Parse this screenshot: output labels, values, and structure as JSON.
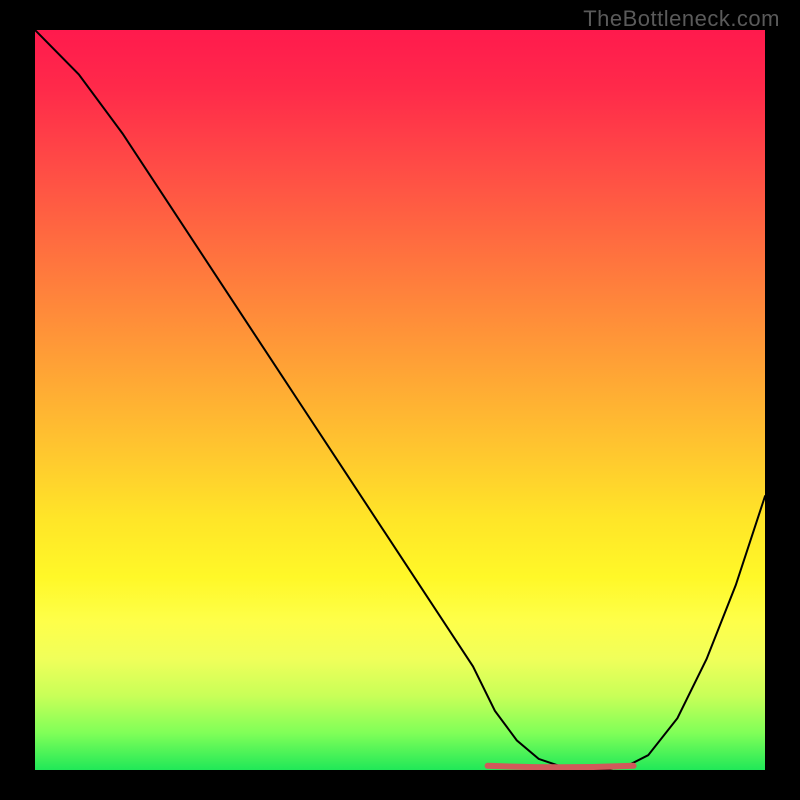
{
  "watermark": "TheBottleneck.com",
  "chart_data": {
    "type": "line",
    "title": "",
    "xlabel": "",
    "ylabel": "",
    "xlim": [
      0,
      100
    ],
    "ylim": [
      0,
      100
    ],
    "grid": false,
    "legend": false,
    "series": [
      {
        "name": "bottleneck-curve",
        "color": "#000000",
        "x": [
          0,
          6,
          12,
          18,
          24,
          30,
          36,
          42,
          48,
          54,
          60,
          63,
          66,
          69,
          72,
          75,
          78,
          81,
          84,
          88,
          92,
          96,
          100
        ],
        "values": [
          100,
          94,
          86,
          77,
          68,
          59,
          50,
          41,
          32,
          23,
          14,
          8,
          4,
          1.5,
          0.5,
          0,
          0,
          0.5,
          2,
          7,
          15,
          25,
          37
        ]
      }
    ],
    "annotations": [
      {
        "name": "valley-marker",
        "type": "segment",
        "color": "#d05a5a",
        "thickness": 6,
        "x_start": 62,
        "x_end": 82,
        "y": 0.3
      }
    ],
    "background_gradient": {
      "direction": "top-to-bottom",
      "stops": [
        {
          "pos": 0,
          "color": "#ff1a4d"
        },
        {
          "pos": 50,
          "color": "#ffaa34"
        },
        {
          "pos": 75,
          "color": "#fff828"
        },
        {
          "pos": 100,
          "color": "#20e858"
        }
      ]
    }
  }
}
